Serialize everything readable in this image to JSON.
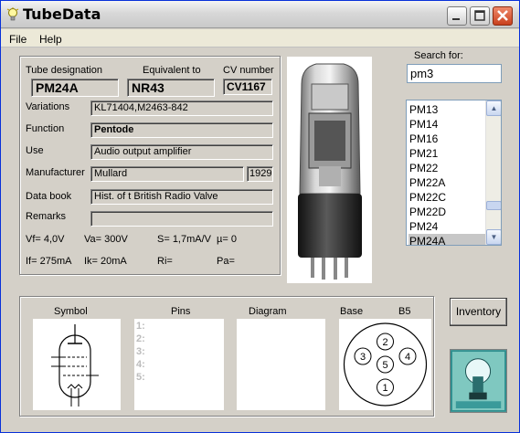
{
  "window": {
    "title": "TubeData"
  },
  "menu": {
    "file": "File",
    "help": "Help"
  },
  "labels": {
    "designation": "Tube designation",
    "equivalent": "Equivalent to",
    "cv": "CV number",
    "variations": "Variations",
    "function": "Function",
    "use": "Use",
    "manufacturer": "Manufacturer",
    "databook": "Data book",
    "remarks": "Remarks",
    "search": "Search for:",
    "symbol": "Symbol",
    "pins": "Pins",
    "diagram": "Diagram",
    "base": "Base"
  },
  "tube": {
    "designation": "PM24A",
    "equivalent": "NR43",
    "cv": "CV1167",
    "variations": "KL71404,M2463-842",
    "function": "Pentode",
    "use": "Audio output amplifier",
    "manufacturer": "Mullard",
    "year": "1929",
    "databook": "Hist. of t British Radio Valve",
    "remarks": "",
    "vf": "Vf= 4,0V",
    "va": "Va=  300V",
    "s": "S= 1,7mA/V",
    "mu": "µ=    0",
    "if": "If= 275mA",
    "ik": "Ik=   20mA",
    "ri": "Ri=",
    "pa": "Pa=",
    "base_type": "B5"
  },
  "search": {
    "value": "pm3"
  },
  "list": {
    "items": [
      "PM13",
      "PM14",
      "PM16",
      "PM21",
      "PM22",
      "PM22A",
      "PM22C",
      "PM22D",
      "PM24",
      "PM24A"
    ],
    "selected_index": 9
  },
  "pins": {
    "numbers": [
      "1:",
      "2:",
      "3:",
      "4:",
      "5:"
    ]
  },
  "base_pins": [
    "1",
    "2",
    "3",
    "4",
    "5"
  ],
  "buttons": {
    "inventory": "Inventory"
  },
  "icons": {
    "app": "lightbulb-icon",
    "list_up": "scroll-up-arrow-icon",
    "list_down": "scroll-down-arrow-icon"
  }
}
